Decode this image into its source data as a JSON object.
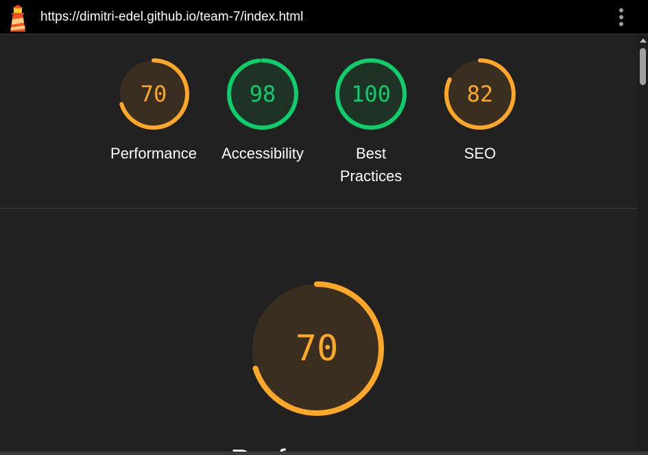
{
  "header": {
    "url": "https://dimitri-edel.github.io/team-7/index.html",
    "logo_icon": "lighthouse-icon",
    "menu_icon": "more-vert-icon"
  },
  "scores": [
    {
      "label": "Performance",
      "score": "70",
      "color": "#ffa726",
      "fill": "#3a2e20"
    },
    {
      "label": "Accessibility",
      "score": "98",
      "color": "#0cce6b",
      "fill": "#1e3326"
    },
    {
      "label": "Best\nPractices",
      "score": "100",
      "color": "#0cce6b",
      "fill": "#1e3326"
    },
    {
      "label": "SEO",
      "score": "82",
      "color": "#ffa726",
      "fill": "#3a2e20"
    }
  ],
  "detail": {
    "score": "70",
    "label": "Performance",
    "color": "#ffa726",
    "fill": "#3a2e20"
  },
  "colors": {
    "background": "#212121",
    "topbar": "#000000",
    "pass": "#0cce6b",
    "average": "#ffa726"
  }
}
